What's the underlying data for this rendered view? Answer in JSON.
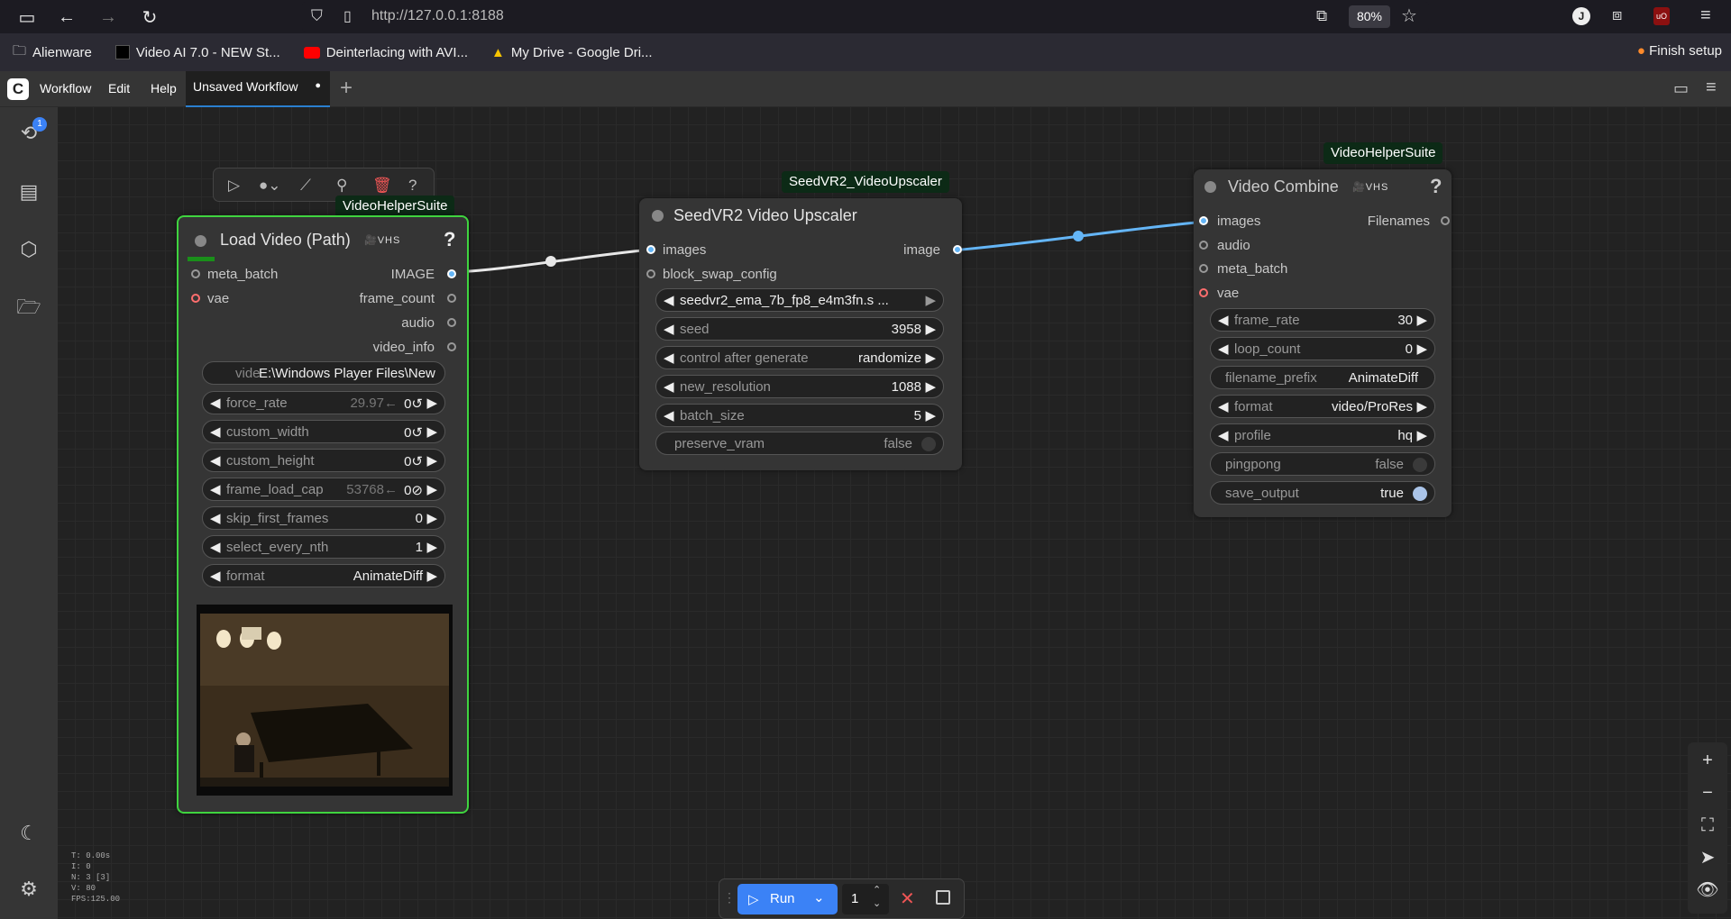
{
  "browser": {
    "url": "http://127.0.0.1:8188",
    "zoom": "80%",
    "bookmarks": [
      "Alienware",
      "Video AI 7.0 - NEW St...",
      "Deinterlacing with AVI...",
      "My Drive - Google Dri..."
    ],
    "finish_setup": "Finish setup"
  },
  "menu": {
    "workflow": "Workflow",
    "edit": "Edit",
    "help": "Help"
  },
  "tab": {
    "label": "Unsaved Workflow",
    "dot": "●",
    "add": "+"
  },
  "queue_badge": "1",
  "nodes": {
    "load": {
      "category": "VideoHelperSuite",
      "title": "Load Video (Path)",
      "badge": "🎥VHS",
      "inputs": [
        "meta_batch",
        "vae"
      ],
      "outputs": [
        "IMAGE",
        "frame_count",
        "audio",
        "video_info"
      ],
      "video_path": "E:\\Windows Player Files\\New f",
      "video_path_label": "vide",
      "widgets": [
        {
          "label": "force_rate",
          "hint": "29.97←",
          "value": "0↺"
        },
        {
          "label": "custom_width",
          "hint": "",
          "value": "0↺"
        },
        {
          "label": "custom_height",
          "hint": "",
          "value": "0↺"
        },
        {
          "label": "frame_load_cap",
          "hint": "53768←",
          "value": "0⊘"
        },
        {
          "label": "skip_first_frames",
          "hint": "",
          "value": "0"
        },
        {
          "label": "select_every_nth",
          "hint": "",
          "value": "1"
        },
        {
          "label": "format",
          "hint": "",
          "value": "AnimateDiff"
        }
      ]
    },
    "seed": {
      "category": "SeedVR2_VideoUpscaler",
      "title": "SeedVR2 Video Upscaler",
      "inputs": [
        "images",
        "block_swap_config"
      ],
      "outputs": [
        "image"
      ],
      "model": "seedvr2_ema_7b_fp8_e4m3fn.s ...",
      "widgets": [
        {
          "label": "seed",
          "value": "3958"
        },
        {
          "label": "control after generate",
          "value": "randomize"
        },
        {
          "label": "new_resolution",
          "value": "1088"
        },
        {
          "label": "batch_size",
          "value": "5"
        }
      ],
      "preserve_vram": {
        "label": "preserve_vram",
        "value": "false"
      }
    },
    "combine": {
      "category": "VideoHelperSuite",
      "title": "Video Combine",
      "badge": "🎥VHS",
      "inputs": [
        "images",
        "audio",
        "meta_batch",
        "vae"
      ],
      "outputs": [
        "Filenames"
      ],
      "widgets": [
        {
          "label": "frame_rate",
          "value": "30"
        },
        {
          "label": "loop_count",
          "value": "0"
        },
        {
          "label": "filename_prefix",
          "value": "AnimateDiff"
        },
        {
          "label": "format",
          "value": "video/ProRes"
        },
        {
          "label": "profile",
          "value": "hq"
        },
        {
          "label": "pingpong",
          "value": "false"
        },
        {
          "label": "save_output",
          "value": "true"
        }
      ]
    }
  },
  "runbar": {
    "run": "Run",
    "count": "1"
  },
  "stats": [
    "T: 0.00s",
    "I: 0",
    "N: 3 [3]",
    "V: 80",
    "FPS:125.00"
  ],
  "colors": {
    "accent": "#3b82f6",
    "selected_border": "#3fd43f",
    "link_image": "#64b5f6",
    "vae_slot": "#ff6e6e"
  }
}
